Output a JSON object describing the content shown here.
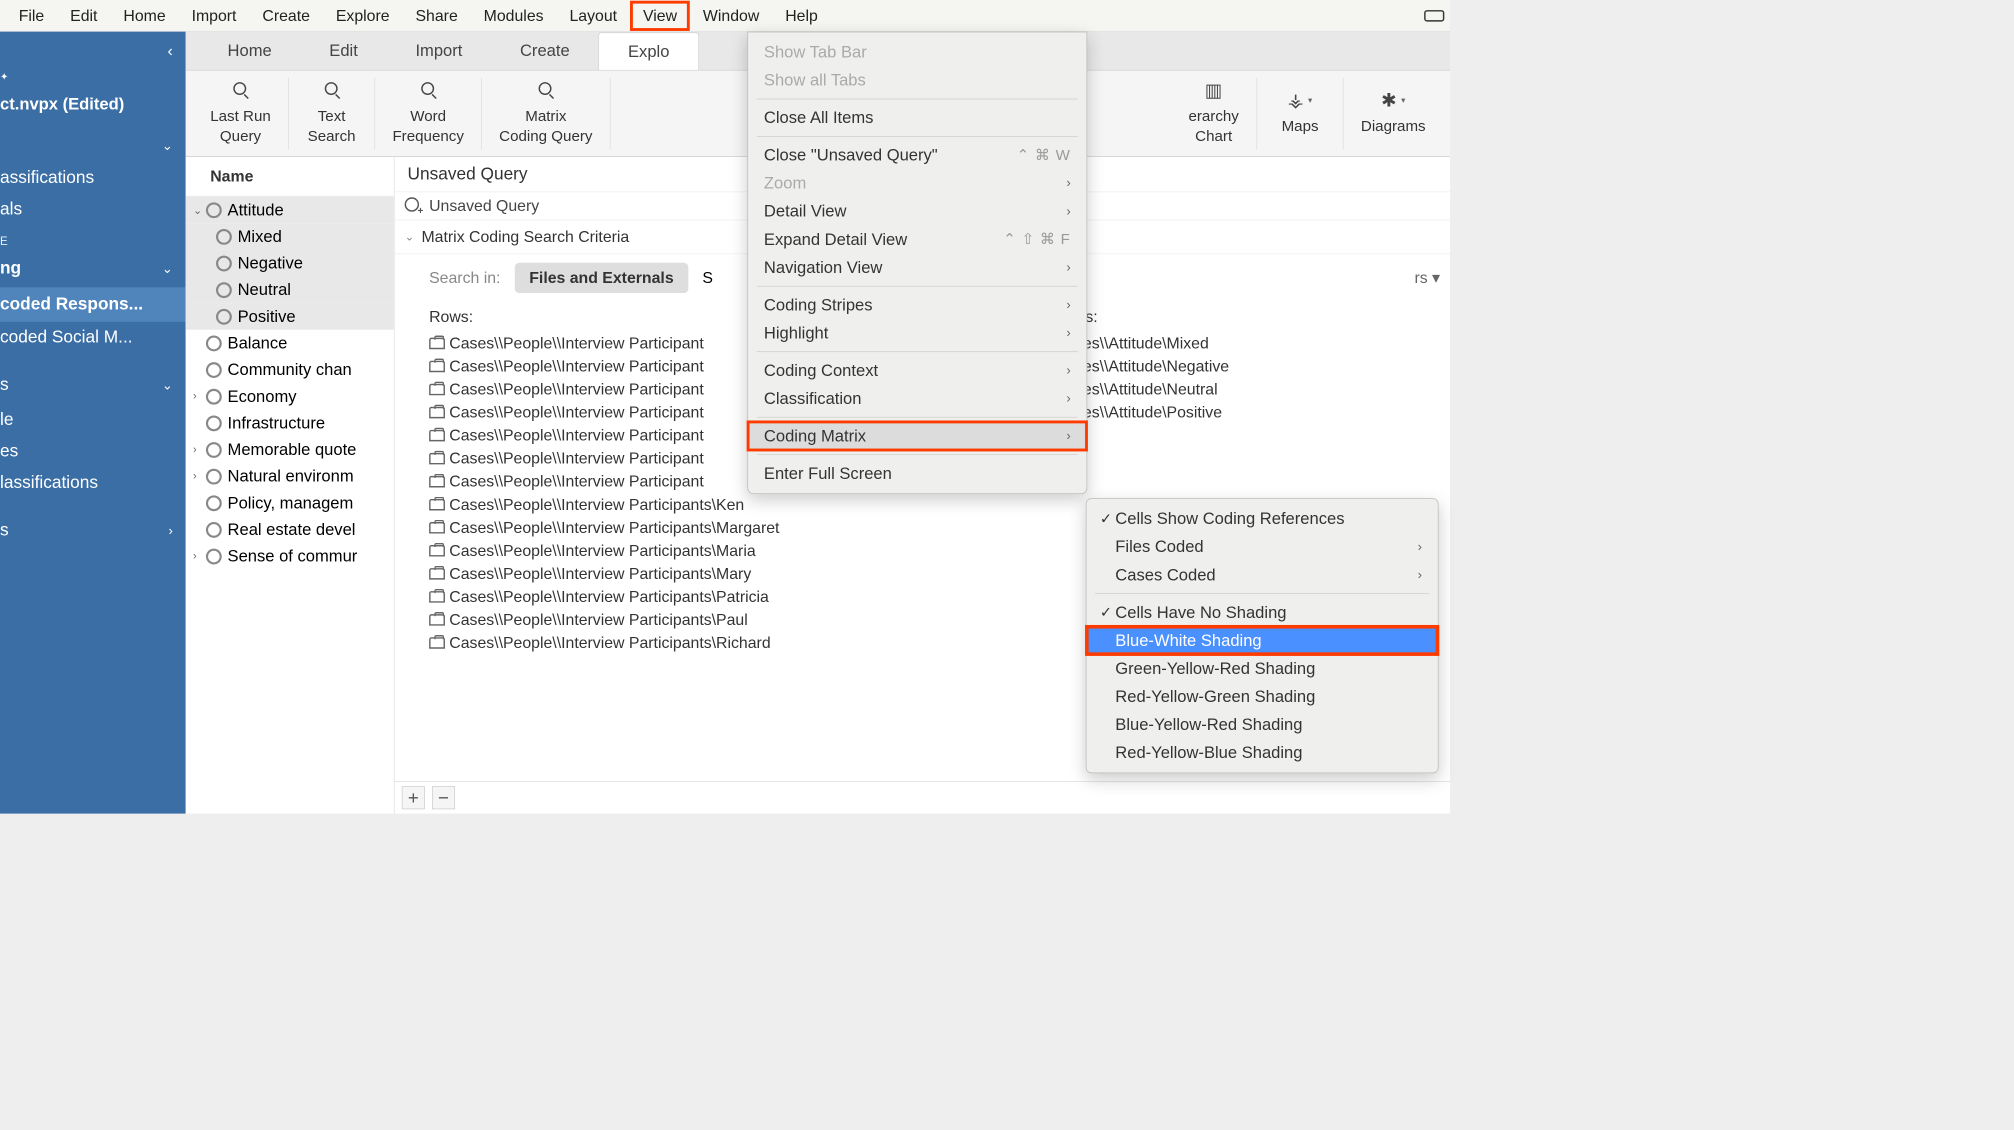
{
  "menubar": {
    "items": [
      "File",
      "Edit",
      "Home",
      "Import",
      "Create",
      "Explore",
      "Share",
      "Modules",
      "Layout",
      "View",
      "Window",
      "Help"
    ],
    "highlighted": "View"
  },
  "sidebar": {
    "project_title": "ct.nvpx (Edited)",
    "items": [
      {
        "label": "assifications"
      },
      {
        "label": "als"
      }
    ],
    "cat_label": "E",
    "selected": "ng",
    "subitems": [
      "coded Respons...",
      "coded Social M..."
    ],
    "sections": [
      {
        "label": "s"
      },
      {
        "label": "le",
        "nochev": true
      },
      {
        "label": "es",
        "nochev": true
      },
      {
        "label": "lassifications",
        "nochev": true
      },
      {
        "label": "s"
      }
    ]
  },
  "ribbon": {
    "tabs": [
      "Home",
      "Edit",
      "Import",
      "Create",
      "Explo"
    ],
    "active": "Explo"
  },
  "toolbar": {
    "items": [
      {
        "icon": "mag-plus",
        "label": "Last Run\nQuery"
      },
      {
        "icon": "mag-t",
        "label": "Text\nSearch"
      },
      {
        "icon": "mag-w",
        "label": "Word\nFrequency"
      },
      {
        "icon": "mag-grid",
        "label": "Matrix\nCoding Query"
      },
      {
        "icon": "bars",
        "label": "erarchy\nChart"
      },
      {
        "icon": "network",
        "label": "Maps",
        "dd": true
      },
      {
        "icon": "flow",
        "label": "Diagrams",
        "dd": true
      }
    ]
  },
  "navlist": {
    "header": "Name",
    "items": [
      {
        "label": "Attitude",
        "disclose": "down",
        "group": true
      },
      {
        "label": "Mixed",
        "child": true
      },
      {
        "label": "Negative",
        "child": true
      },
      {
        "label": "Neutral",
        "child": true
      },
      {
        "label": "Positive",
        "child": true
      },
      {
        "label": "Balance"
      },
      {
        "label": "Community chan"
      },
      {
        "label": "Economy",
        "disclose": "right"
      },
      {
        "label": "Infrastructure"
      },
      {
        "label": "Memorable quote",
        "disclose": "right"
      },
      {
        "label": "Natural environm",
        "disclose": "right"
      },
      {
        "label": "Policy, managem"
      },
      {
        "label": "Real estate devel"
      },
      {
        "label": "Sense of commur",
        "disclose": "right"
      }
    ]
  },
  "query": {
    "title": "Unsaved Query",
    "tab_label": "Unsaved Query",
    "criteria_label": "Matrix Coding Search Criteria",
    "search_in_label": "Search in:",
    "search_in_value": "Files and Externals",
    "search_in_extra": "S",
    "rows_label": "Rows:",
    "columns_label": "Columns:",
    "filters_label": "rs ▾",
    "rows": [
      "Cases\\\\People\\\\Interview Participant",
      "Cases\\\\People\\\\Interview Participant",
      "Cases\\\\People\\\\Interview Participant",
      "Cases\\\\People\\\\Interview Participant",
      "Cases\\\\People\\\\Interview Participant",
      "Cases\\\\People\\\\Interview Participant",
      "Cases\\\\People\\\\Interview Participant",
      "Cases\\\\People\\\\Interview Participants\\Ken",
      "Cases\\\\People\\\\Interview Participants\\Margaret",
      "Cases\\\\People\\\\Interview Participants\\Maria",
      "Cases\\\\People\\\\Interview Participants\\Mary",
      "Cases\\\\People\\\\Interview Participants\\Patricia",
      "Cases\\\\People\\\\Interview Participants\\Paul",
      "Cases\\\\People\\\\Interview Participants\\Richard"
    ],
    "columns": [
      "Codes\\\\Attitude\\Mixed",
      "Codes\\\\Attitude\\Negative",
      "Codes\\\\Attitude\\Neutral",
      "Codes\\\\Attitude\\Positive"
    ]
  },
  "viewmenu": {
    "items": [
      {
        "label": "Show Tab Bar",
        "disabled": true
      },
      {
        "label": "Show all Tabs",
        "disabled": true
      },
      {
        "sep": true
      },
      {
        "label": "Close All Items"
      },
      {
        "sep": true
      },
      {
        "label": "Close \"Unsaved Query\"",
        "shortcut": "⌃ ⌘ W"
      },
      {
        "label": "Zoom",
        "disabled": true,
        "sub": true
      },
      {
        "label": "Detail View",
        "sub": true
      },
      {
        "label": "Expand Detail View",
        "shortcut": "⌃ ⇧ ⌘ F"
      },
      {
        "label": "Navigation View",
        "sub": true
      },
      {
        "sep": true
      },
      {
        "label": "Coding Stripes",
        "sub": true
      },
      {
        "label": "Highlight",
        "sub": true
      },
      {
        "sep": true
      },
      {
        "label": "Coding Context",
        "sub": true
      },
      {
        "label": "Classification",
        "sub": true
      },
      {
        "sep": true
      },
      {
        "label": "Coding Matrix",
        "sub": true,
        "highlighted": true
      },
      {
        "sep": true
      },
      {
        "label": "Enter Full Screen"
      }
    ]
  },
  "submenu": {
    "items": [
      {
        "label": "Cells Show Coding References",
        "check": true
      },
      {
        "label": "Files Coded",
        "sub": true
      },
      {
        "label": "Cases Coded",
        "sub": true
      },
      {
        "sep": true
      },
      {
        "label": "Cells Have No Shading",
        "check": true
      },
      {
        "label": "Blue-White Shading",
        "selected": true,
        "boxed": true
      },
      {
        "label": "Green-Yellow-Red Shading"
      },
      {
        "label": "Red-Yellow-Green Shading"
      },
      {
        "label": "Blue-Yellow-Red Shading"
      },
      {
        "label": "Red-Yellow-Blue Shading"
      }
    ]
  }
}
